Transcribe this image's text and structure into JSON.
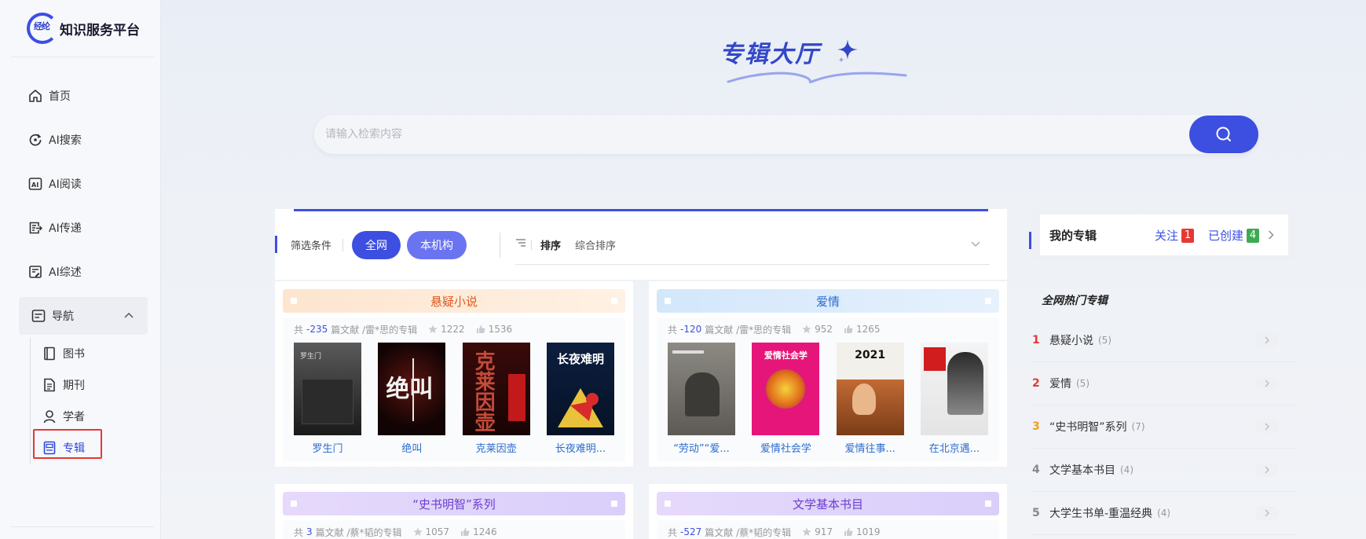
{
  "sidebar": {
    "logo_mark": "经纶",
    "logo_title": "知识服务平台",
    "items": [
      {
        "label": "首页",
        "icon": "home-icon"
      },
      {
        "label": "AI搜索",
        "icon": "ai-search-icon"
      },
      {
        "label": "AI阅读",
        "icon": "ai-read-icon"
      },
      {
        "label": "AI传递",
        "icon": "ai-deliver-icon"
      },
      {
        "label": "AI综述",
        "icon": "ai-review-icon"
      }
    ],
    "group": {
      "label": "导航",
      "icon": "nav-icon"
    },
    "sub_items": [
      {
        "label": "图书",
        "icon": "book-icon"
      },
      {
        "label": "期刊",
        "icon": "journal-icon"
      },
      {
        "label": "学者",
        "icon": "scholar-icon"
      },
      {
        "label": "专辑",
        "icon": "album-icon"
      }
    ]
  },
  "header": {
    "title": "专辑大厅",
    "search_placeholder": "请输入检索内容"
  },
  "filter": {
    "label": "筛选条件",
    "options": [
      "全网",
      "本机构"
    ],
    "sort_label": "排序",
    "sort_value": "综合排序"
  },
  "albums": [
    {
      "title": "悬疑小说",
      "theme": "orange",
      "meta_prefix": "共",
      "count": "-235",
      "meta_suffix": "篇文献 /雷*思的专辑",
      "stars": "1222",
      "likes": "1536",
      "books": [
        "罗生门",
        "绝叫",
        "克莱因壶",
        "长夜难明..."
      ]
    },
    {
      "title": "爱情",
      "theme": "blue",
      "meta_prefix": "共",
      "count": "-120",
      "meta_suffix": "篇文献 /雷*思的专辑",
      "stars": "952",
      "likes": "1265",
      "books": [
        "“劳动”“爱...",
        "爱情社会学",
        "爱情往事...",
        "在北京遇..."
      ]
    },
    {
      "title": "“史书明智”系列",
      "theme": "purple",
      "meta_prefix": "共",
      "count": "3",
      "meta_suffix": "篇文献 /蔡*韬的专辑",
      "stars": "1057",
      "likes": "1246"
    },
    {
      "title": "文学基本书目",
      "theme": "purple",
      "meta_prefix": "共",
      "count": "-527",
      "meta_suffix": "篇文献 /蔡*韬的专辑",
      "stars": "917",
      "likes": "1019"
    }
  ],
  "cover_texts": {
    "b1": "罗生门",
    "b2": "绝叫",
    "b3": "克莱因壶",
    "b4": "长夜难明",
    "b6": "爱情社会学",
    "b7": "2021"
  },
  "my_albums": {
    "title": "我的专辑",
    "follow_label": "关注",
    "follow_count": "1",
    "created_label": "已创建",
    "created_count": "4"
  },
  "hot": {
    "title": "全网热门专辑",
    "items": [
      {
        "rank": "1",
        "name": "悬疑小说",
        "count": "(5)",
        "color": "#e53935"
      },
      {
        "rank": "2",
        "name": "爱情",
        "count": "(5)",
        "color": "#e53935"
      },
      {
        "rank": "3",
        "name": "“史书明智”系列",
        "count": "(7)",
        "color": "#f0a020"
      },
      {
        "rank": "4",
        "name": "文学基本书目",
        "count": "(4)",
        "color": "#888888"
      },
      {
        "rank": "5",
        "name": "大学生书单-重温经典",
        "count": "(4)",
        "color": "#888888"
      }
    ]
  },
  "colors": {
    "accent": "#3d4fe0",
    "active_box": "#e53935"
  }
}
